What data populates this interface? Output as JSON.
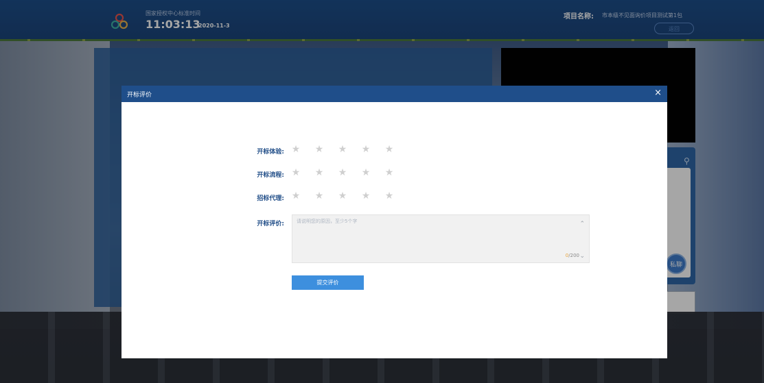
{
  "header": {
    "clock_caption": "国家授权中心标准时间",
    "time": "11:03:13",
    "date": "2020-11-3",
    "project_label": "项目名称:",
    "project_name": "市本级不见面询价项目测试第1包",
    "back_label": "返回"
  },
  "side": {
    "private_chat_label": "私聊"
  },
  "dialog": {
    "title": "开标评价",
    "close_glyph": "×",
    "ratings": [
      {
        "label": "开标体验:",
        "stars": 5,
        "value": 0
      },
      {
        "label": "开标流程:",
        "stars": 5,
        "value": 0
      },
      {
        "label": "招标代理:",
        "stars": 5,
        "value": 0
      }
    ],
    "comment_label": "开标评价:",
    "comment_placeholder": "请说明您的原因，至少5个字",
    "comment_current": "0",
    "comment_max": "/200",
    "submit_label": "提交评价"
  },
  "colors": {
    "header_bg": "#1f4e8a",
    "submit_bg": "#3d8fde",
    "label_color": "#214e88",
    "star_inactive": "#cfcfcf"
  },
  "icons": [
    "logo-icon",
    "search-icon",
    "close-icon",
    "star-icon",
    "scroll-up-icon",
    "scroll-down-icon"
  ]
}
